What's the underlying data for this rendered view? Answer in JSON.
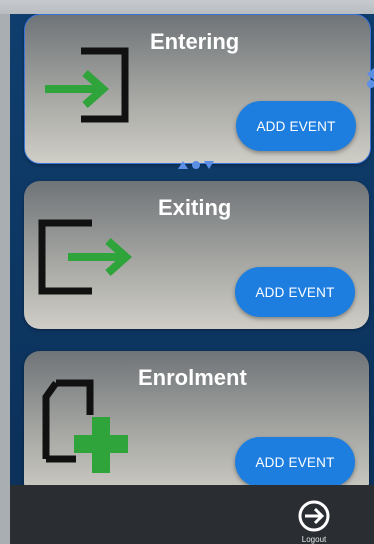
{
  "cards": [
    {
      "title": "Entering",
      "button": "ADD EVENT",
      "icon": "entering-icon"
    },
    {
      "title": "Exiting",
      "button": "ADD EVENT",
      "icon": "exiting-icon"
    },
    {
      "title": "Enrolment",
      "button": "ADD EVENT",
      "icon": "enrolment-icon"
    }
  ],
  "bottom_nav": {
    "logout_label": "Logout",
    "icon": "logout-icon"
  },
  "colors": {
    "accent": "#1e7ee0",
    "icon_green": "#2ea43a",
    "icon_black": "#111111",
    "background": "#0b2f57"
  }
}
